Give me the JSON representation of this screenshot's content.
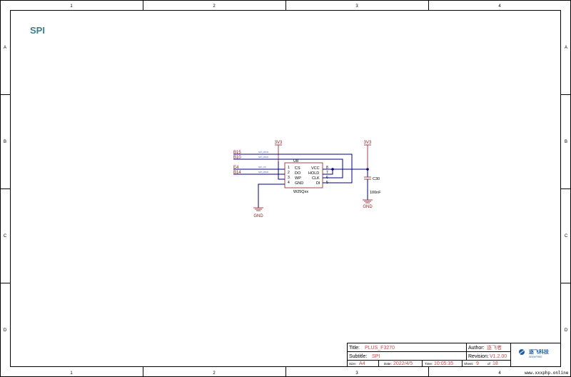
{
  "sheet": {
    "title": "SPI",
    "columns": [
      "1",
      "2",
      "3",
      "4"
    ],
    "rows": [
      "A",
      "B",
      "C",
      "D"
    ]
  },
  "schematic": {
    "chip": {
      "designator": "U8",
      "part": "W25Qxx",
      "left_pins": [
        {
          "num": "1",
          "name": "CS"
        },
        {
          "num": "2",
          "name": "DO"
        },
        {
          "num": "3",
          "name": "WP"
        },
        {
          "num": "4",
          "name": "GND"
        }
      ],
      "right_pins": [
        {
          "num": "8",
          "name": "VCC"
        },
        {
          "num": "7",
          "name": "HOLD"
        },
        {
          "num": "6",
          "name": "CLK"
        },
        {
          "num": "5",
          "name": "DI"
        }
      ]
    },
    "net_ports": [
      "B15",
      "B10",
      "E4",
      "B14"
    ],
    "net_labels": [
      "SPI_MOSI",
      "SPI_MISO",
      "SPI_CS",
      "SPI_MISO"
    ],
    "power_3v3_a": "3V3",
    "power_3v3_b": "3V3",
    "gnd_a": "GND",
    "gnd_b": "GND",
    "cap": {
      "designator": "C30",
      "value": "100nF"
    }
  },
  "title_block": {
    "title_label": "Title:",
    "title_value": "PLUS_F3270",
    "subtitle_label": "Subtitle:",
    "subtitle_value": "SPI",
    "author_label": "Author:",
    "author_value": "逐飞者",
    "revision_label": "Revision:",
    "revision_value": "V1.2.00",
    "size_label": "Size:",
    "size_value": "A4",
    "date_label": "Date:",
    "date_value": "2022/4/5",
    "time_label": "Time:",
    "time_value": "10:05:35",
    "sheet_label": "Sheet:",
    "sheet_value": "9",
    "of_label": "of",
    "of_value": "18",
    "company": "逐飞科技",
    "company_en": "SEEKFREE",
    "watermark": "www.xxxphp.online"
  }
}
